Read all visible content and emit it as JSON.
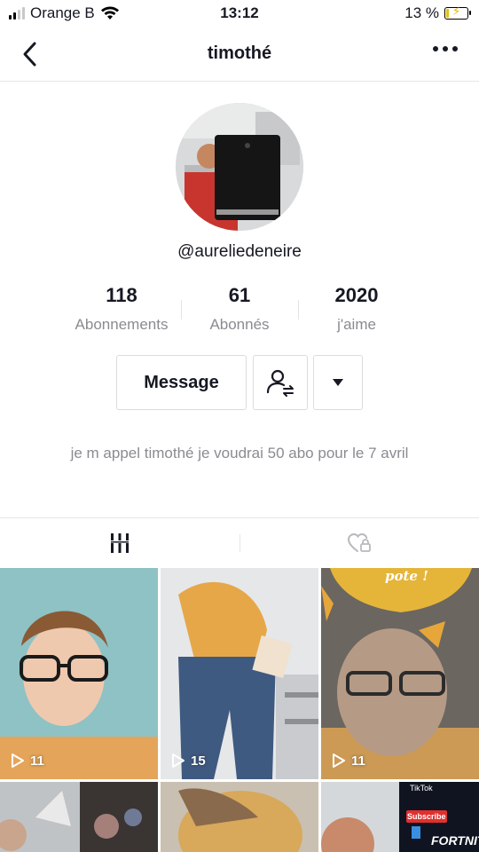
{
  "status_bar": {
    "carrier": "Orange B",
    "time": "13:12",
    "battery": "13 %",
    "battery_level": 0.13
  },
  "nav": {
    "title": "timothé"
  },
  "profile": {
    "handle": "@aureliedeneire",
    "stats": [
      {
        "value": "118",
        "label": "Abonnements"
      },
      {
        "value": "61",
        "label": "Abonnés"
      },
      {
        "value": "2020",
        "label": "j'aime"
      }
    ],
    "message_label": "Message",
    "bio": "je m appel  timothé  je voudrai 50 abo pour le 7 avril"
  },
  "tabs": [
    {
      "icon": "grid-icon",
      "active": true
    },
    {
      "icon": "heart-lock-icon",
      "active": false
    }
  ],
  "videos": [
    {
      "views": "11"
    },
    {
      "views": "15"
    },
    {
      "views": "11",
      "overlay_text": "pote !"
    },
    {
      "views": ""
    },
    {
      "views": ""
    },
    {
      "views": "",
      "overlay_text": [
        "TikTok",
        "Subscribe",
        "FORTNITE"
      ]
    }
  ]
}
